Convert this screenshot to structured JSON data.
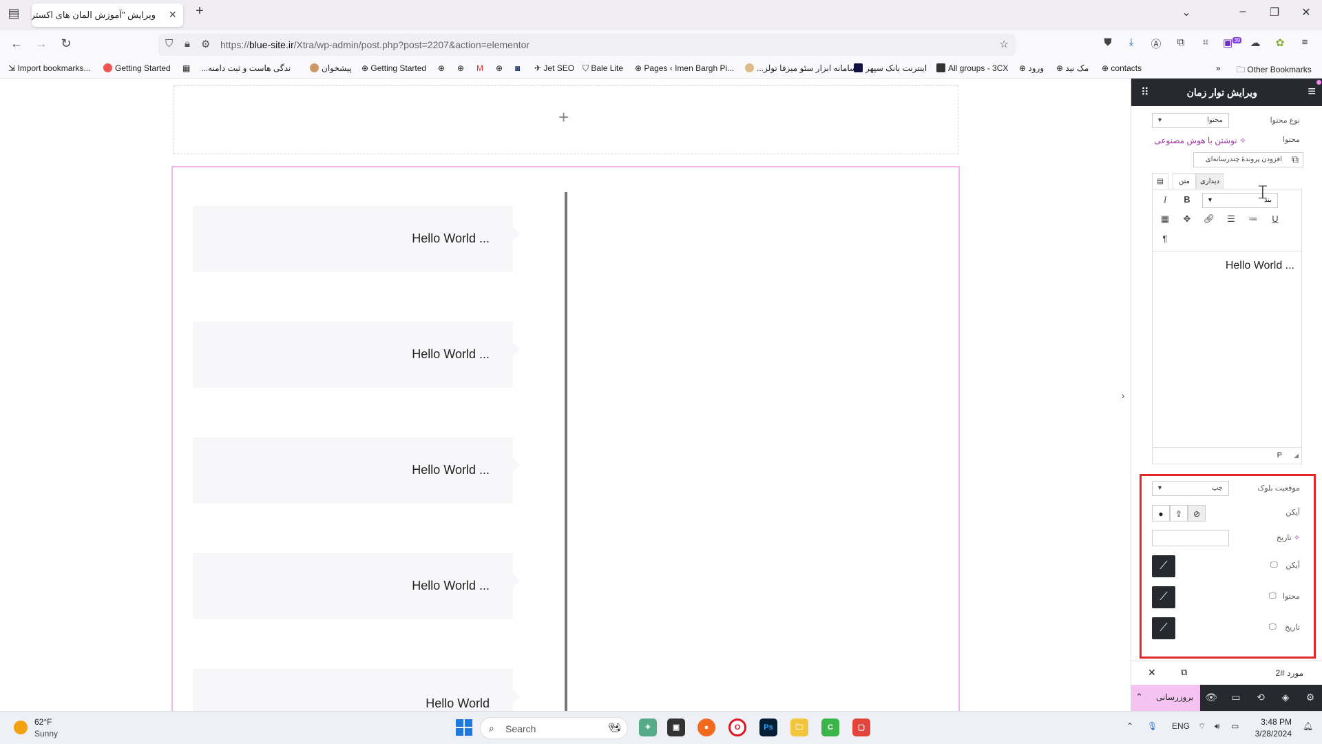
{
  "browser": {
    "tab_title": "ویرایش \"آموزش المان های اکسترا – ...",
    "url_prefix": "https://",
    "url_domain": "blue-site.ir",
    "url_path": "/Xtra/wp-admin/post.php?post=2207&action=elementor",
    "badge_count": "39"
  },
  "bookmarks": [
    "Import bookmarks...",
    "Getting Started",
    "...ندگی هاست و ثبت دامنه",
    "پیشخوان",
    "Getting Started",
    "Jet SEO",
    "Bale Lite",
    "Pages ‹ Imen Bargh Pi...",
    "...سامانه ابزار سئو میزفا تولز",
    "اینترنت بانک سپهر",
    "All groups - 3CX",
    "ورود",
    "مک نید",
    "contacts",
    "Other Bookmarks"
  ],
  "canvas": {
    "plus": "+",
    "cards": [
      "Hello World ...",
      "Hello World ...",
      "Hello World ...",
      "Hello World ...",
      "Hello World"
    ]
  },
  "panel": {
    "title": "ویرایش توار زمان",
    "content_type_label": "نوع محتوا",
    "content_type_value": "محتوا",
    "content_label": "محتوا",
    "ai_link": "نوشتن با هوش مصنوعی",
    "add_media": "افزودن پروندهٔ چندرسانه‌ای",
    "tab_visual": "دیداری",
    "tab_text": "متن",
    "format_select": "بند",
    "editor_text": "Hello World ...",
    "editor_status": "P",
    "block_position_label": "موقعیت بلوک",
    "block_position_value": "چپ",
    "icon_label": "آیکن",
    "date_label": "تاریخ",
    "icon_label_2": "آیکن",
    "content_label_2": "محتوا",
    "date_label_2": "تاریخ",
    "item_label": "مورد #2",
    "update_button": "بروزرسانی"
  },
  "taskbar": {
    "temp": "62°F",
    "weather": "Sunny",
    "search": "Search",
    "lang": "ENG",
    "time": "3:48 PM",
    "date": "3/28/2024"
  }
}
